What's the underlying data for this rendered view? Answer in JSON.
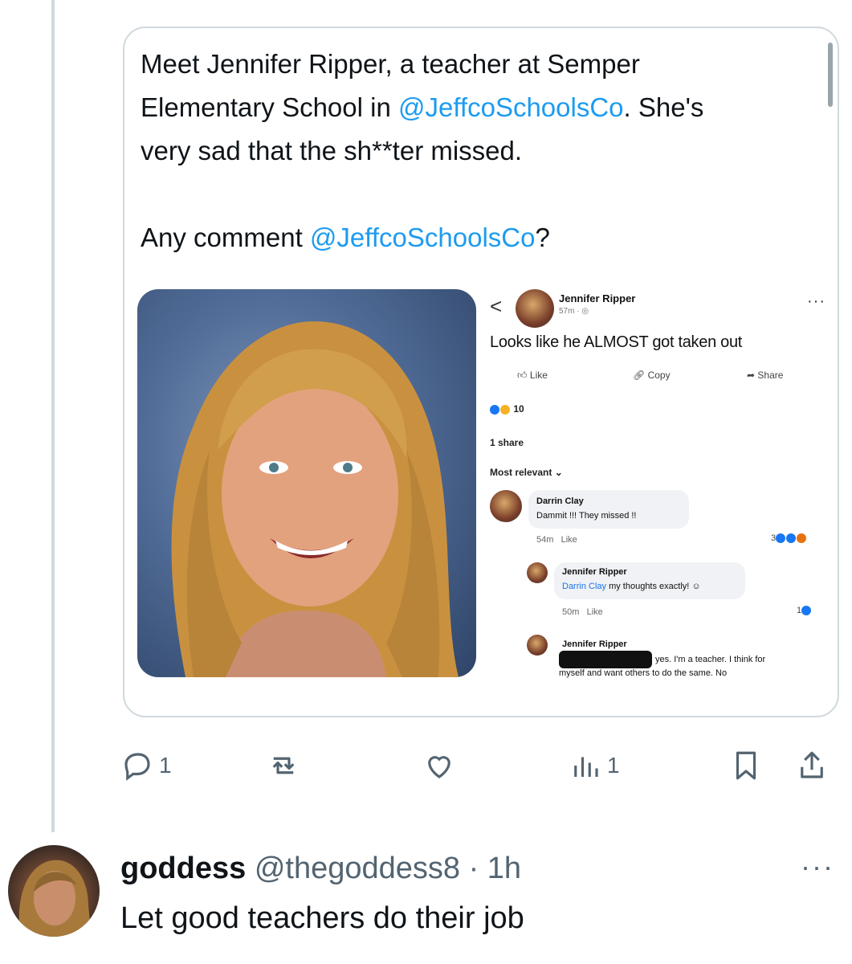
{
  "quote": {
    "line1": "Meet Jennifer Ripper, a teacher at Semper",
    "line2_pre": "Elementary School in ",
    "line2_mention": "@JeffcoSchoolsCo",
    "line2_post": ". She's",
    "line3": "very sad that the sh**ter missed.",
    "line4_pre": "Any comment ",
    "line4_mention": "@JeffcoSchoolsCo",
    "line4_post": "?"
  },
  "fb": {
    "back": "<",
    "author": "Jennifer Ripper",
    "time": "57m · ",
    "more": "···",
    "post_text": "Looks like he ALMOST got taken out",
    "like": "Like",
    "copy": "Copy",
    "share": "Share",
    "reaction_count": "10",
    "shares": "1 share",
    "sort": "Most relevant",
    "comments": [
      {
        "name": "Darrin Clay",
        "text": "Dammit !!! They missed !!",
        "time": "54m",
        "like": "Like",
        "reacts": "3"
      },
      {
        "name": "Jennifer Ripper",
        "mention": "Darrin Clay",
        "text": " my thoughts exactly!",
        "time": "50m",
        "like": "Like",
        "reacts": "1"
      },
      {
        "name": "Jennifer Ripper",
        "text1": "yes. I'm a teacher. I think for",
        "text2_prefix": "myself",
        "text2": " and want others to do the same. No"
      }
    ]
  },
  "actions": {
    "reply_count": "1",
    "views_count": "1"
  },
  "reply": {
    "display_name": "goddess",
    "handle": "@thegoddess8",
    "separator": " · ",
    "time": "1h",
    "more": "···",
    "text": "Let good teachers do their job"
  },
  "colors": {
    "accent": "#1d9bf0",
    "muted": "#536471",
    "border": "#cfd9de",
    "fb_blue": "#1b74e4"
  }
}
